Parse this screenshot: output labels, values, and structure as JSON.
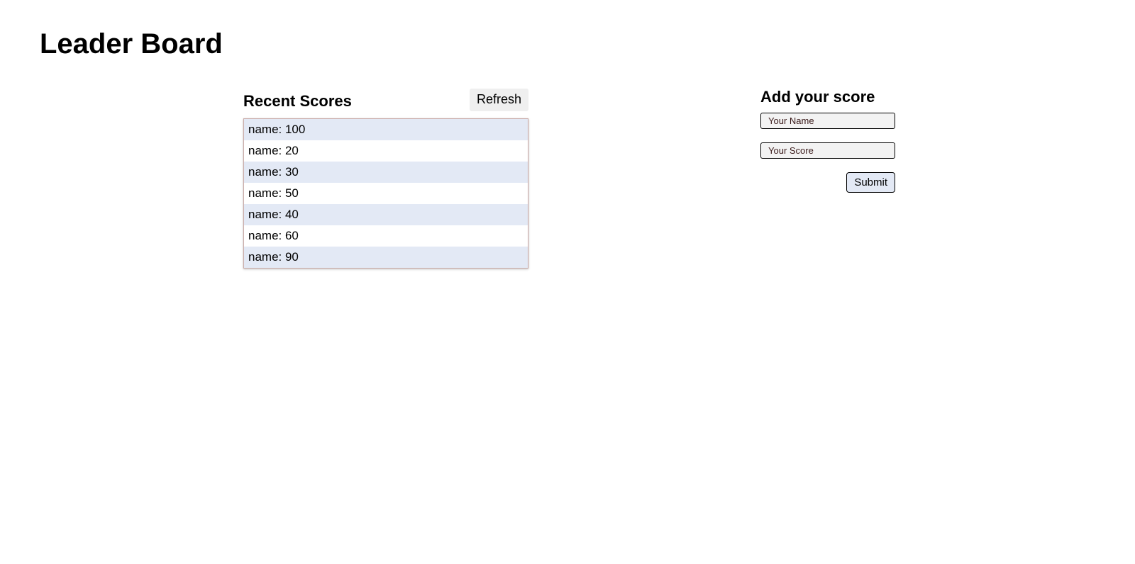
{
  "page": {
    "title": "Leader Board"
  },
  "recent_scores": {
    "title": "Recent Scores",
    "refresh_label": "Refresh",
    "items": [
      {
        "text": "name: 100"
      },
      {
        "text": "name: 20"
      },
      {
        "text": "name: 30"
      },
      {
        "text": "name: 50"
      },
      {
        "text": "name: 40"
      },
      {
        "text": "name: 60"
      },
      {
        "text": "name: 90"
      }
    ]
  },
  "add_score": {
    "title": "Add your score",
    "name_placeholder": "Your Name",
    "name_value": "",
    "score_placeholder": "Your Score",
    "score_value": "",
    "submit_label": "Submit"
  },
  "colors": {
    "row_alt": "#e3e9f5",
    "row": "#ffffff",
    "list_border": "#c9a9a6",
    "refresh_bg": "#efefef",
    "submit_bg": "#e3e9f5"
  }
}
